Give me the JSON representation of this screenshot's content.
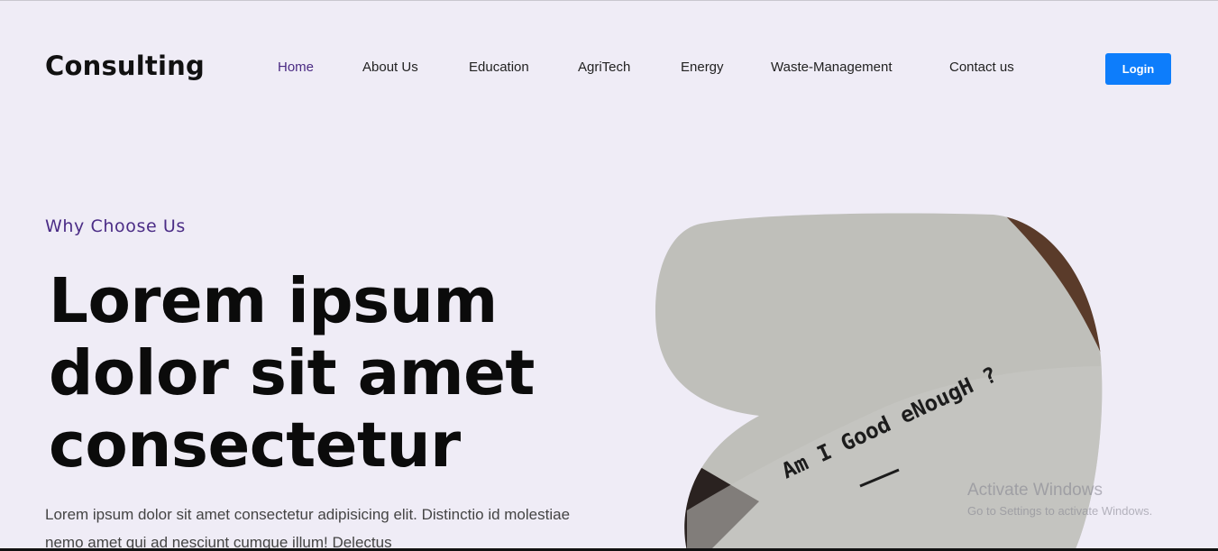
{
  "header": {
    "brand": "Consulting",
    "nav": [
      {
        "label": "Home",
        "active": true
      },
      {
        "label": "About Us"
      },
      {
        "label": "Education"
      },
      {
        "label": "AgriTech"
      },
      {
        "label": "Energy"
      },
      {
        "label": "Waste-Management"
      },
      {
        "label": "Contact us"
      }
    ],
    "login_label": "Login"
  },
  "hero": {
    "eyebrow": "Why Choose Us",
    "headline": "Lorem ipsum dolor sit amet consectetur",
    "body": "Lorem ipsum dolor sit amet consectetur adipisicing elit. Distinctio id molestiae nemo amet qui ad nesciunt cumque illum! Delectus",
    "image_text": "Am I Good eNougH ?"
  },
  "watermark": {
    "title": "Activate Windows",
    "subtitle": "Go to Settings to activate Windows."
  },
  "colors": {
    "background": "#efecf6",
    "accent": "#4a2a83",
    "button": "#0d7dfb"
  }
}
